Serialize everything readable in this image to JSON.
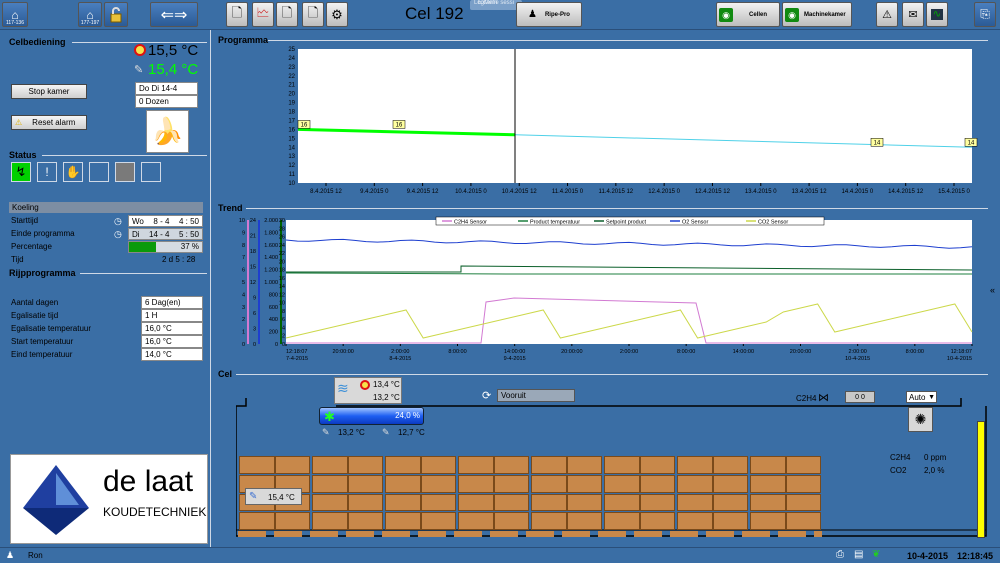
{
  "toolbar": {
    "btn1_label": "117-136",
    "btn2_label": "177-197",
    "title": "Cel 192",
    "ext_label": "Externe sessi",
    "logmein": "LogMeIn",
    "ripe_label": "Ripe-Pro",
    "cellen_label": "Cellen",
    "machinekamer_label": "Machinekamer"
  },
  "celbediening": {
    "title": "Celbediening",
    "temp_setpoint": "15,5 °C",
    "temp_actual": "15,4 °C",
    "stop_label": "Stop kamer",
    "reset_label": "Reset alarm",
    "day_field": "Do Di 14-4",
    "dozen_field": "0 Dozen"
  },
  "status": {
    "title": "Status"
  },
  "koeling": {
    "title": "Koeling",
    "starttijd_label": "Starttijd",
    "starttijd_day": "Wo",
    "starttijd_date": "8 - 4",
    "starttijd_time": "4 : 50",
    "einde_label": "Einde programma",
    "einde_day": "Di",
    "einde_date": "14 - 4",
    "einde_time": "5 : 50",
    "percentage_label": "Percentage",
    "percentage_value": "37 %",
    "percentage_fraction": 0.37,
    "tijd_label": "Tijd",
    "tijd_value": "2 d  5 : 28"
  },
  "rijpprogramma": {
    "title": "Rijpprogramma",
    "rows": [
      {
        "label": "Aantal dagen",
        "value": "6 Dag(en)"
      },
      {
        "label": "Egalisatie tijd",
        "value": "1 H"
      },
      {
        "label": "Egalisatie temperatuur",
        "value": "16,0 °C"
      },
      {
        "label": "Start temperatuur",
        "value": "16,0 °C"
      },
      {
        "label": "Eind temperatuur",
        "value": "14,0 °C"
      }
    ]
  },
  "logo": {
    "name": "de laat",
    "sub": "KOUDETECHNIEK"
  },
  "programma": {
    "title": "Programma",
    "yticks": [
      "25",
      "24",
      "23",
      "22",
      "21",
      "20",
      "19",
      "18",
      "17",
      "16",
      "15",
      "14",
      "13",
      "12",
      "11",
      "10"
    ],
    "xticks": [
      "8.4.2015 12",
      "9.4.2015 0",
      "9.4.2015 12",
      "10.4.2015 0",
      "10.4.2015 12",
      "11.4.2015 0",
      "11.4.2015 12",
      "12.4.2015 0",
      "12.4.2015 12",
      "13.4.2015 0",
      "13.4.2015 12",
      "14.4.2015 0",
      "14.4.2015 12",
      "15.4.2015 0"
    ],
    "markers": [
      "16",
      "16",
      "14",
      "14"
    ]
  },
  "trend": {
    "title": "Trend",
    "legend": [
      "C2H4 Sensor",
      "Product temperatuur",
      "Setpoint product",
      "O2 Sensor",
      "CO2 Sensor"
    ],
    "axis1": [
      "10",
      "9",
      "8",
      "7",
      "6",
      "5",
      "4",
      "3",
      "2",
      "1",
      "0"
    ],
    "axis2": [
      "24",
      "21",
      "18",
      "15",
      "12",
      "9",
      "6",
      "3",
      "0"
    ],
    "axis3": [
      "2.000",
      "1.800",
      "1.600",
      "1.400",
      "1.200",
      "1.000",
      "800",
      "600",
      "400",
      "200",
      "0"
    ],
    "axis4": [
      "30",
      "28",
      "26",
      "24",
      "22",
      "20",
      "18",
      "16",
      "14",
      "12",
      "10",
      "8",
      "6",
      "4",
      "2",
      "0"
    ],
    "xticks": [
      "12:18:07",
      "20:00:00",
      "2:00:00",
      "8:00:00",
      "14:00:00",
      "20:00:00",
      "2:00:00",
      "8:00:00",
      "14:00:00",
      "20:00:00",
      "2:00:00",
      "8:00:00",
      "12:18:07"
    ],
    "xdates": [
      "7-4-2015",
      "8-4-2015",
      "9-4-2015",
      "10-4-2015",
      "10-4-2015"
    ]
  },
  "cel": {
    "title": "Cel",
    "supply_temp1": "13,4 °C",
    "supply_temp2": "13,2 °C",
    "vooruit": "Vooruit",
    "fan_percent": "24,0 %",
    "coil_temp1": "13,2 °C",
    "coil_temp2": "12,7 °C",
    "c2h4_label": "C2H4",
    "c2h4_value": "0 0",
    "auto_label": "Auto",
    "product_temp": "15,4 °C",
    "c2h4_ppm_label": "C2H4",
    "c2h4_ppm": "0 ppm",
    "co2_label": "CO2",
    "co2_value": "2,0 %"
  },
  "statusbar": {
    "user": "Ron",
    "date": "10-4-2015",
    "time": "12:18:45"
  },
  "colors": {
    "bg": "#3a6ea5",
    "green": "#00ff00",
    "cyan": "#4fd1e8",
    "blue": "#1e3fcf",
    "yellow": "#ffff00",
    "pink": "#d27ad2",
    "dkgreen": "#006400",
    "crate": "#c8884a"
  }
}
